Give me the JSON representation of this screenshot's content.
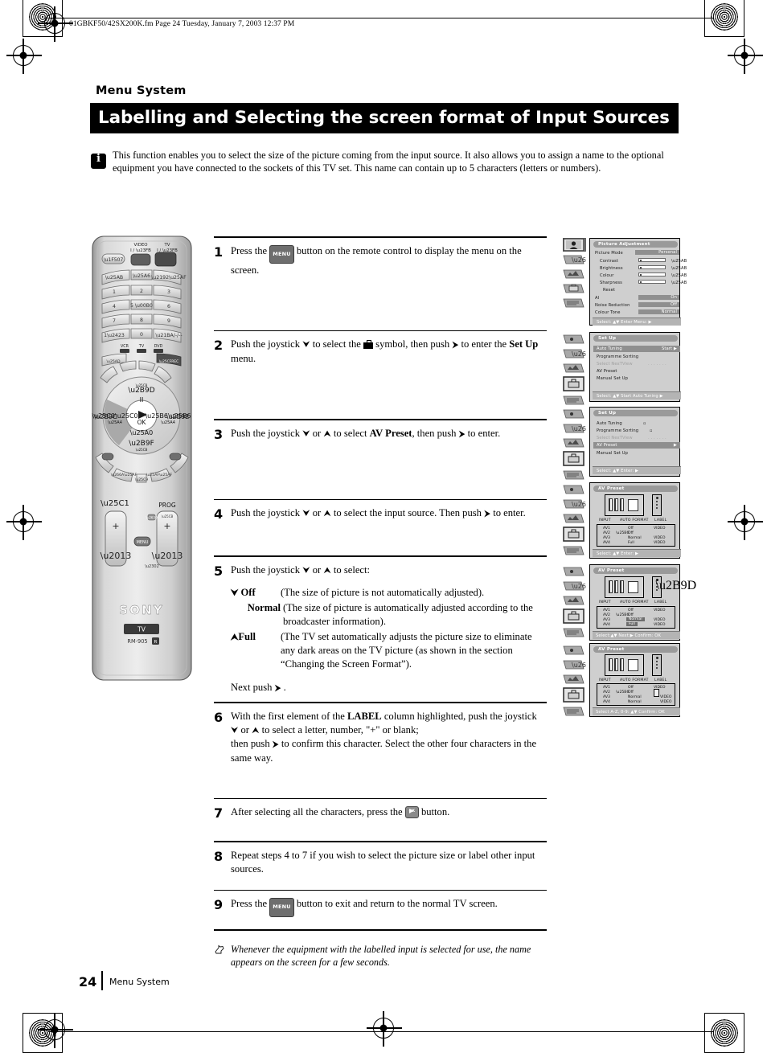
{
  "print": {
    "filename": "01GBKF50/42SX200K.fm  Page 24  Tuesday, January 7, 2003  12:37 PM"
  },
  "header": {
    "section": "Menu System",
    "title": "Labelling and Selecting the screen format of Input Sources"
  },
  "intro": {
    "icon": "info-icon",
    "text": "This function enables you to select the size of the picture coming from the input source. It also allows you to assign a name to the optional equipment you have connected to the sockets of this TV set. This name can contain up to 5 characters (letters or numbers)."
  },
  "remote": {
    "brand": "SONY",
    "mode_label": "TV",
    "model": "RM-905",
    "model_suffix": "R",
    "top_labels": {
      "video": "VIDEO",
      "video_power": "I / ⏻",
      "tv": "TV",
      "tv_power": "I / ⏻"
    },
    "keypad": [
      "1",
      "2",
      "3",
      "4",
      "5",
      "6",
      "7",
      "8",
      "9",
      "0"
    ],
    "keypad_extra": {
      "ten": "1␣",
      "pip": "•••",
      "swap": "↺ / -/--"
    },
    "device_labels": [
      "VCR",
      "TV",
      "DVD"
    ],
    "transport": {
      "play": "▶",
      "ok": "OK",
      "pause": "II",
      "stop": "■"
    },
    "bottom_labels": {
      "volume": "◁",
      "prog": "PROG",
      "menu": "MENU",
      "plus": "+",
      "minus": "–"
    }
  },
  "steps": [
    {
      "num": "1",
      "parts": [
        {
          "t": "text",
          "v": "Press the "
        },
        {
          "t": "menu-btn",
          "v": "MENU"
        },
        {
          "t": "text",
          "v": " button on the remote control to display the menu on the screen."
        }
      ]
    },
    {
      "num": "2",
      "parts": [
        {
          "t": "text",
          "v": "Push the joystick "
        },
        {
          "t": "arrow",
          "v": "⮟"
        },
        {
          "t": "text",
          "v": " to select the "
        },
        {
          "t": "setup-icon",
          "v": "setup-symbol"
        },
        {
          "t": "text",
          "v": " symbol, then push "
        },
        {
          "t": "arrow",
          "v": "⮞"
        },
        {
          "t": "text",
          "v": " to enter the "
        },
        {
          "t": "bold",
          "v": "Set Up"
        },
        {
          "t": "text",
          "v": " menu."
        }
      ]
    },
    {
      "num": "3",
      "parts": [
        {
          "t": "text",
          "v": "Push the joystick "
        },
        {
          "t": "arrow",
          "v": "⮟"
        },
        {
          "t": "text",
          "v": " or "
        },
        {
          "t": "arrow",
          "v": "⮝"
        },
        {
          "t": "text",
          "v": " to select "
        },
        {
          "t": "bold",
          "v": "AV Preset"
        },
        {
          "t": "text",
          "v": ", then push "
        },
        {
          "t": "arrow",
          "v": "⮞"
        },
        {
          "t": "text",
          "v": " to enter."
        }
      ]
    },
    {
      "num": "4",
      "parts": [
        {
          "t": "text",
          "v": "Push the joystick "
        },
        {
          "t": "arrow",
          "v": "⮟"
        },
        {
          "t": "text",
          "v": " or "
        },
        {
          "t": "arrow",
          "v": "⮝"
        },
        {
          "t": "text",
          "v": " to select the input source. Then push "
        },
        {
          "t": "arrow",
          "v": "⮞"
        },
        {
          "t": "text",
          "v": " to enter."
        }
      ]
    },
    {
      "num": "5",
      "parts": [
        {
          "t": "text",
          "v": "Push the joystick "
        },
        {
          "t": "arrow",
          "v": "⮟"
        },
        {
          "t": "text",
          "v": " or "
        },
        {
          "t": "arrow",
          "v": "⮝"
        },
        {
          "t": "text",
          "v": " to select:"
        }
      ]
    },
    {
      "num": "6",
      "parts": [
        {
          "t": "text",
          "v": "With the first element of the "
        },
        {
          "t": "bold",
          "v": "LABEL"
        },
        {
          "t": "text",
          "v": " column highlighted, push the joystick "
        },
        {
          "t": "arrow",
          "v": "⮟"
        },
        {
          "t": "text",
          "v": " or "
        },
        {
          "t": "arrow",
          "v": "⮝"
        },
        {
          "t": "text",
          "v": " to select a letter, number, \"+\" or blank; then push "
        },
        {
          "t": "arrow",
          "v": "⮞"
        },
        {
          "t": "text",
          "v": " to confirm this character. Select the other four characters in the same way."
        }
      ]
    },
    {
      "num": "7",
      "parts": [
        {
          "t": "text",
          "v": "After selecting all the characters, press the "
        },
        {
          "t": "ok-btn",
          "v": "OK"
        },
        {
          "t": "text",
          "v": " button."
        }
      ]
    },
    {
      "num": "8",
      "parts": [
        {
          "t": "text",
          "v": "Repeat steps 4 to 7 if you wish to select the picture size or label other input sources."
        }
      ]
    },
    {
      "num": "9",
      "parts": [
        {
          "t": "text",
          "v": "Press the "
        },
        {
          "t": "menu-btn",
          "v": "MENU"
        },
        {
          "t": "text",
          "v": " button to exit and return to the normal TV screen."
        }
      ]
    }
  ],
  "step5_options": [
    {
      "arrow": "⮟",
      "key": "Off",
      "desc": "(The size of picture is not automatically adjusted)."
    },
    {
      "arrow": "",
      "key": "Normal",
      "desc": "(The size of picture is automatically adjusted according to the broadcaster information)."
    },
    {
      "arrow": "⮝",
      "key": "Full",
      "desc": "(The TV set automatically adjusts the picture size to eliminate any dark areas on the TV picture (as shown in the section “Changing the Screen Format”)."
    }
  ],
  "step5_next": {
    "before": "Next push ",
    "arrow": "⮞",
    "after": " ."
  },
  "tip": {
    "icon": "hand-pointer-icon",
    "text": "Whenever the equipment with the labelled input is selected for use, the name appears on the screen for a few seconds."
  },
  "osd_screens": [
    {
      "id": "picture-adjustment",
      "title": "Picture Adjustment",
      "active_sidebar": 0,
      "rows": [
        {
          "label": "Picture Mode",
          "value": "Personal",
          "type": "value"
        },
        {
          "label": "Contrast",
          "type": "bar",
          "fill": 0.3
        },
        {
          "label": "Brightness",
          "type": "bar",
          "fill": 0.5
        },
        {
          "label": "Colour",
          "type": "bar",
          "fill": 0.5
        },
        {
          "label": "Sharpness",
          "type": "bar",
          "fill": 0.35
        },
        {
          "label": "Reset",
          "type": "plain"
        },
        {
          "label": "AI",
          "value": "On",
          "type": "value"
        },
        {
          "label": "Noise Reduction",
          "value": "Off",
          "type": "value"
        },
        {
          "label": "Colour Tone",
          "value": "Normal",
          "type": "value"
        }
      ],
      "footer": "Select: ▲▼  Enter Menu: ▶"
    },
    {
      "id": "set-up-auto-tuning",
      "title": "Set Up",
      "active_sidebar": 3,
      "rows": [
        {
          "label": "Auto Tuning",
          "value": "Start ▶",
          "type": "hl"
        },
        {
          "label": "Programme Sorting",
          "type": "plain"
        },
        {
          "label": "Select NexTView",
          "type": "dim",
          "value": ". . . . . . ."
        },
        {
          "label": "AV Preset",
          "type": "plain"
        },
        {
          "label": "Manual Set Up",
          "type": "plain"
        }
      ],
      "footer": "Select: ▲▼  Start Auto Tuning ▶"
    },
    {
      "id": "set-up-av-preset",
      "title": "Set Up",
      "active_sidebar": 3,
      "rows": [
        {
          "label": "Auto Tuning",
          "type": "plain",
          "value": "▫"
        },
        {
          "label": "Programme Sorting",
          "type": "plain",
          "value": "▫"
        },
        {
          "label": "Select NexTView",
          "type": "dim",
          "value": ". . . . . . ."
        },
        {
          "label": "AV Preset",
          "type": "hl",
          "value": "▶"
        },
        {
          "label": "Manual Set Up",
          "type": "plain"
        }
      ],
      "footer": "Select: ▲▼  Enter: ▶"
    },
    {
      "id": "av-preset-input-select",
      "title": "AV Preset",
      "active_sidebar": 3,
      "table": {
        "headers": [
          "INPUT",
          "AUTO FORMAT",
          "LABEL"
        ],
        "rows": [
          {
            "input": "AV1",
            "format": "Off",
            "label": "VIDEO",
            "cursor": false
          },
          {
            "input": "AV2",
            "format": "Off",
            "label": "",
            "cursor": true
          },
          {
            "input": "AV3",
            "format": "Normal",
            "label": "VIDEO",
            "cursor": false
          },
          {
            "input": "AV4",
            "format": "Full",
            "label": "VIDEO",
            "cursor": false
          }
        ],
        "highlight": "none"
      },
      "footer": "Select: ▲▼          Enter: ▶"
    },
    {
      "id": "av-preset-format-select",
      "title": "AV Preset",
      "active_sidebar": 3,
      "table": {
        "headers": [
          "INPUT",
          "AUTO FORMAT",
          "LABEL"
        ],
        "rows": [
          {
            "input": "AV1",
            "format": "Off",
            "label": "VIDEO",
            "cursor": false
          },
          {
            "input": "AV2",
            "format": "Off",
            "label": "",
            "cursor": true
          },
          {
            "input": "AV3",
            "format": "Normal",
            "label": "VIDEO",
            "cursor": false
          },
          {
            "input": "AV4",
            "format": "Full",
            "label": "VIDEO",
            "cursor": false
          }
        ],
        "highlight": "format"
      },
      "footer": "Select:▲▼ Next:▶ Confirm: OK"
    },
    {
      "id": "av-preset-label-edit",
      "title": "AV Preset",
      "active_sidebar": 3,
      "table": {
        "headers": [
          "INPUT",
          "AUTO FORMAT",
          "LABEL"
        ],
        "rows": [
          {
            "input": "AV1",
            "format": "Off",
            "label": "VIDEO",
            "cursor": false
          },
          {
            "input": "AV2",
            "format": "Off",
            "label": "",
            "cursor": true
          },
          {
            "input": "AV3",
            "format": "Normal",
            "label": "VIDEO",
            "cursor": false
          },
          {
            "input": "AV4",
            "format": "Normal",
            "label": "VIDEO",
            "cursor": false
          }
        ],
        "highlight": "label"
      },
      "footer": "Select A-Z, 0-9: ▲▼ Confirm: OK"
    }
  ],
  "footer": {
    "page_number": "24",
    "label": "Menu System"
  }
}
